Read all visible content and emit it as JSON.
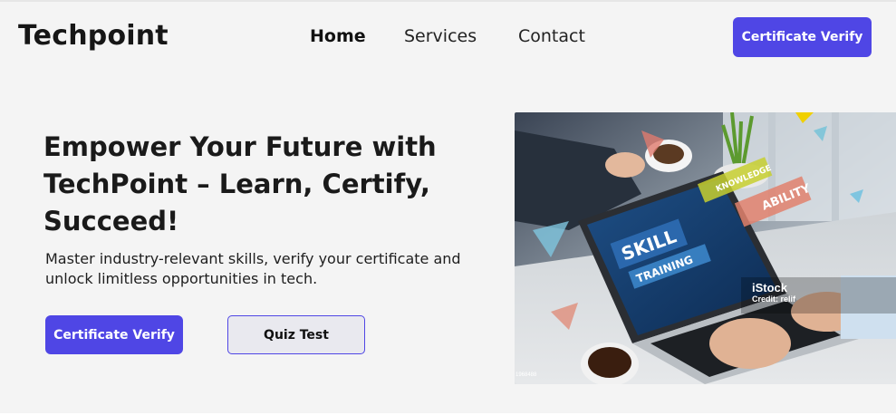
{
  "header": {
    "logo": "Techpoint",
    "nav": [
      {
        "label": "Home",
        "active": true
      },
      {
        "label": "Services",
        "active": false
      },
      {
        "label": "Contact",
        "active": false
      }
    ],
    "cta_label": "Certificate Verify"
  },
  "hero": {
    "title": "Empower Your Future with TechPoint – Learn, Certify, Succeed!",
    "subtitle": "Master industry-relevant skills, verify your certificate and unlock limitless opportunities in tech.",
    "primary_button": "Certificate Verify",
    "secondary_button": "Quiz Test",
    "image": {
      "screen_words": [
        "SKILL",
        "TRAINING",
        "KNOWLEDGE",
        "ABILITY"
      ],
      "watermark_brand": "iStock",
      "watermark_credit": "Credit: relif",
      "image_id_text": "1968488"
    }
  },
  "colors": {
    "accent": "#4f46e5",
    "background": "#f4f4f4",
    "text": "#111111",
    "secondary_button_bg": "#e9e9ef"
  }
}
